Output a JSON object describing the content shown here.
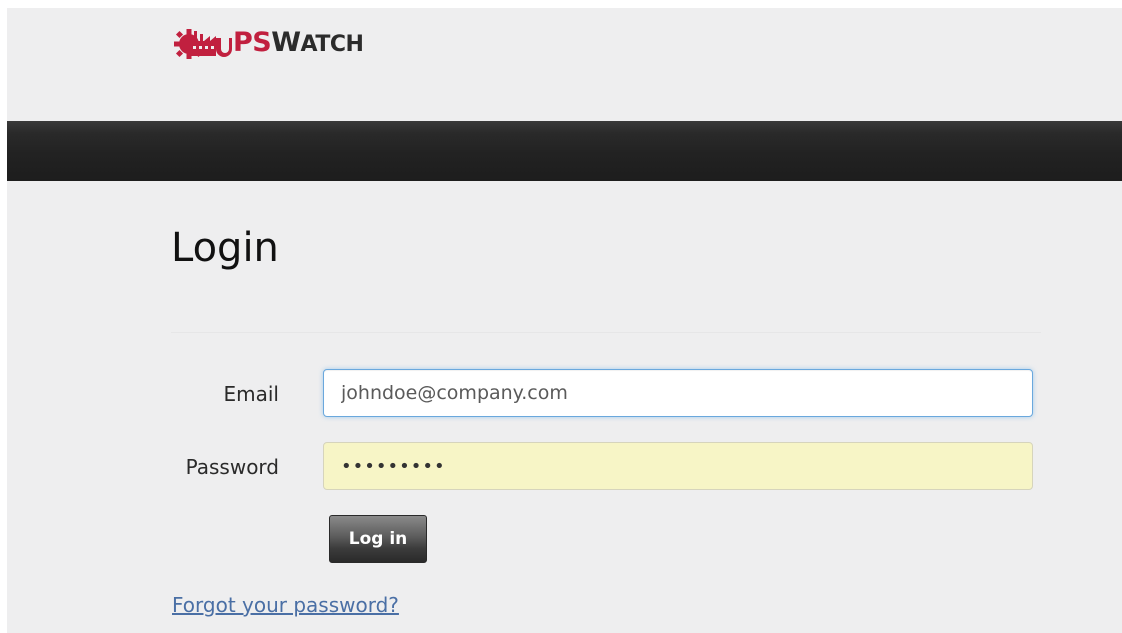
{
  "header": {
    "logo": {
      "icon": "factory-gear-icon",
      "text_prefix": "",
      "text_ps": "PS",
      "text_w": "W",
      "text_rest": "ATCH"
    }
  },
  "login": {
    "title": "Login",
    "email_label": "Email",
    "email_value": "johndoe@company.com",
    "password_label": "Password",
    "password_value": "•••••••••",
    "submit_label": "Log in",
    "forgot_label": "Forgot your password?"
  },
  "colors": {
    "brand": "#c1203f",
    "navbar": "#222222",
    "link": "#4a6fa5",
    "autofill": "#f7f5c6",
    "focus": "#6aa8dd"
  }
}
